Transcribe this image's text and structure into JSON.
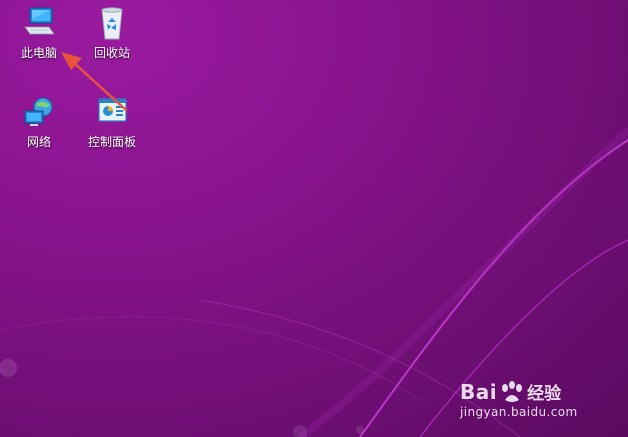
{
  "desktop": {
    "icons": [
      {
        "label": "此电脑",
        "icon": "computer-icon"
      },
      {
        "label": "回收站",
        "icon": "recycle-bin-icon"
      },
      {
        "label": "网络",
        "icon": "network-icon"
      },
      {
        "label": "控制面板",
        "icon": "control-panel-icon"
      }
    ]
  },
  "annotation": {
    "color": "#e8533c",
    "points_to": "此电脑"
  },
  "watermark": {
    "brand": "Bai",
    "suffix": "经验",
    "domain": "jingyan.baidu.com"
  },
  "colors": {
    "wallpaper_base": "#7a1180",
    "wallpaper_highlight": "#9a1aa0",
    "curve_accent": "#c33cd0"
  }
}
